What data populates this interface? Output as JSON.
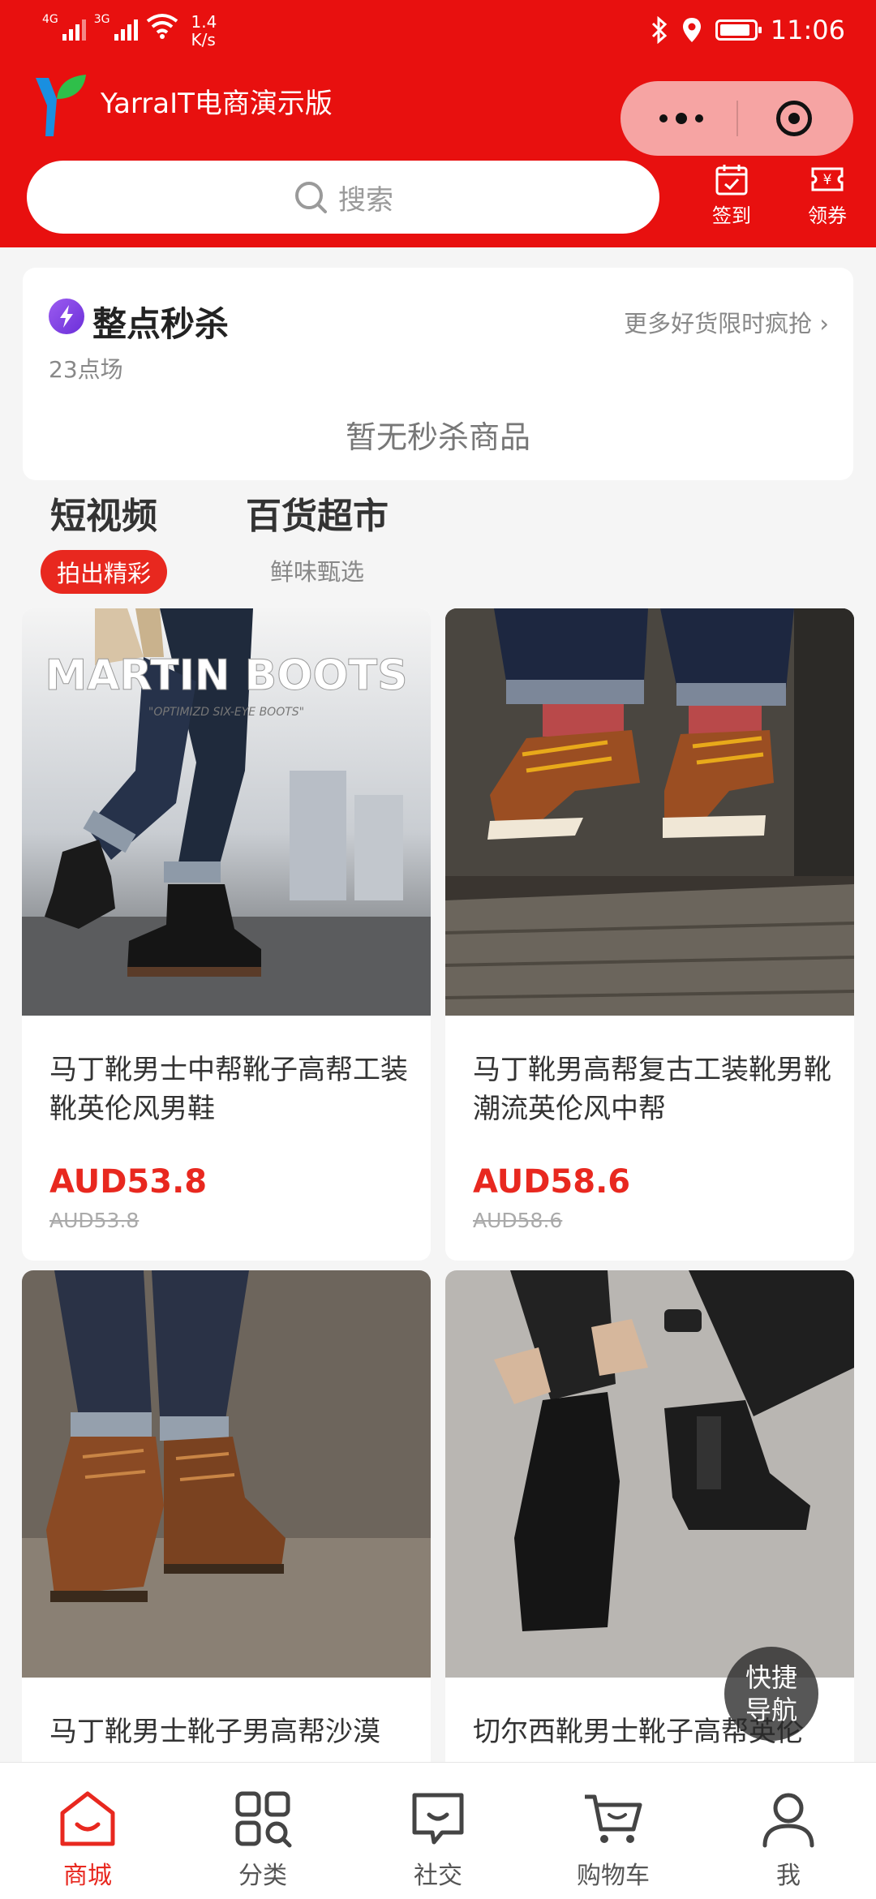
{
  "status_bar": {
    "sim1": "4G",
    "sim2": "3G",
    "speed_value": "1.4",
    "speed_unit": "K/s",
    "time": "11:06",
    "battery_level": 0.9
  },
  "header": {
    "app_title": "YarraIT电商演示版"
  },
  "search": {
    "placeholder": "搜索"
  },
  "quick_actions": [
    {
      "label": "签到",
      "icon": "calendar-check-icon"
    },
    {
      "label": "领券",
      "icon": "coupon-icon"
    }
  ],
  "flash_sale": {
    "title": "整点秒杀",
    "more_link": "更多好货限时疯抢",
    "session": "23点场",
    "empty_text": "暂无秒杀商品"
  },
  "tabs": [
    {
      "title": "短视频",
      "subtitle": "拍出精彩",
      "active": true
    },
    {
      "title": "百货超市",
      "subtitle": "鲜味甄选",
      "active": false
    }
  ],
  "products": [
    {
      "name": "马丁靴男士中帮靴子高帮工装靴英伦风男鞋",
      "price": "AUD53.8",
      "original_price": "AUD53.8",
      "image_text": "MARTIN BOOTS",
      "image_subtext": "\"OPTIMIZD SIX-EYE BOOTS\""
    },
    {
      "name": "马丁靴男高帮复古工装靴男靴潮流英伦风中帮",
      "price": "AUD58.6",
      "original_price": "AUD58.6"
    },
    {
      "name": "马丁靴男士靴子男高帮沙漠"
    },
    {
      "name": "切尔西靴男士靴子高帮英伦"
    }
  ],
  "fab": {
    "label_line1": "快捷",
    "label_line2": "导航"
  },
  "bottom_nav": [
    {
      "label": "商城",
      "icon": "home-icon",
      "active": true
    },
    {
      "label": "分类",
      "icon": "category-icon",
      "active": false
    },
    {
      "label": "社交",
      "icon": "chat-icon",
      "active": false
    },
    {
      "label": "购物车",
      "icon": "cart-icon",
      "active": false
    },
    {
      "label": "我",
      "icon": "user-icon",
      "active": false
    }
  ],
  "colors": {
    "brand_red": "#e8100f",
    "price_red": "#e8281f",
    "flash_purple": "#7a3ee6"
  }
}
